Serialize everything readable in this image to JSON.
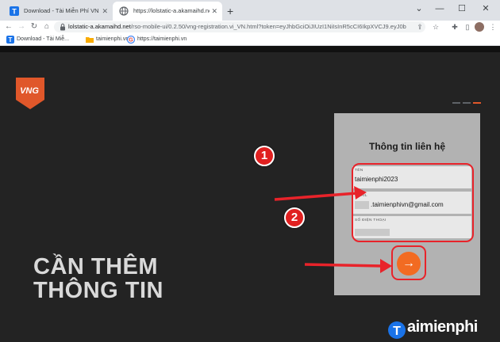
{
  "browser": {
    "tabs": [
      {
        "title": "Download - Tài Miễn Phí VN - Pi",
        "active": false,
        "icon": "taimienphi-favicon"
      },
      {
        "title": "https://lolstatic-a.akamaihd.net/r",
        "active": true,
        "icon": "globe-icon"
      }
    ],
    "new_tab": "+",
    "controls": {
      "tab_search": "⌄",
      "minimize": "—",
      "maximize": "☐",
      "close": "✕"
    },
    "url_host": "lolstatic-a.akamaihd.net",
    "url_path": "/rso-mobile-ui/0.2.50/vng-registration.vi_VN.html?token=eyJhbGciOiJIUzI1NiIsInR5cCI6IkpXVCJ9.eyJ0b",
    "bookmarks": [
      {
        "label": "Download - Tài Miễ...",
        "icon": "taimienphi-favicon"
      },
      {
        "label": "taimienphi.vn",
        "icon": "folder-icon"
      },
      {
        "label": "https://taimienphi.vn",
        "icon": "google-icon"
      }
    ]
  },
  "page": {
    "headline_line1": "CẦN THÊM",
    "headline_line2": "THÔNG TIN",
    "form": {
      "title": "Thông tin liên hệ",
      "name_label": "TÊN",
      "name_value": "taimienphi2023",
      "email_label": "EMAIL",
      "email_value": ".taimienphivn@gmail.com",
      "phone_label": "SỐ ĐIỆN THOẠI",
      "next_symbol": "→"
    },
    "progress_step": 3,
    "progress_total": 3
  },
  "annotations": {
    "step1": "1",
    "step2": "2",
    "color": "#e8232a"
  },
  "watermark": {
    "text": "aimienphi"
  },
  "colors": {
    "accent": "#f26b22",
    "vng": "#e0572a",
    "annotation": "#e02020"
  }
}
